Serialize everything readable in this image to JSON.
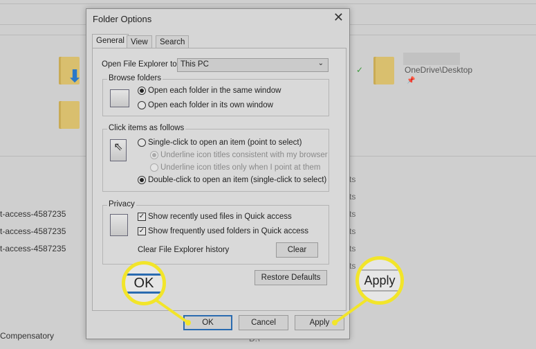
{
  "background": {
    "onedrive_label": "OneDrive\\Desktop",
    "list_items": [
      "t-access-4587235",
      "t-access-4587235",
      "t-access-4587235"
    ],
    "ts_items": [
      "ts",
      "ts",
      "ts",
      "ts",
      "ts",
      "ts"
    ],
    "bottom_item": "Compensatory",
    "bottom_path": "D:\\"
  },
  "dialog": {
    "title": "Folder Options",
    "close_icon": "close-icon",
    "tabs": [
      {
        "label": "General",
        "active": true
      },
      {
        "label": "View"
      },
      {
        "label": "Search"
      }
    ],
    "open_to": {
      "label": "Open File Explorer to:",
      "value": "This PC"
    },
    "browse": {
      "title": "Browse folders",
      "options": [
        {
          "label": "Open each folder in the same window",
          "selected": true
        },
        {
          "label": "Open each folder in its own window",
          "selected": false
        }
      ]
    },
    "click": {
      "title": "Click items as follows",
      "single": "Single-click to open an item (point to select)",
      "underline_browser": "Underline icon titles consistent with my browser",
      "underline_point": "Underline icon titles only when I point at them",
      "double": "Double-click to open an item (single-click to select)"
    },
    "privacy": {
      "title": "Privacy",
      "recent_files": "Show recently used files in Quick access",
      "frequent_folders": "Show frequently used folders in Quick access",
      "clear_label": "Clear File Explorer history",
      "clear_button": "Clear"
    },
    "restore_defaults": "Restore Defaults",
    "ok": "OK",
    "cancel": "Cancel",
    "apply": "Apply"
  },
  "callouts": {
    "ok": "OK",
    "apply": "Apply",
    "color": "#f2e52a"
  }
}
